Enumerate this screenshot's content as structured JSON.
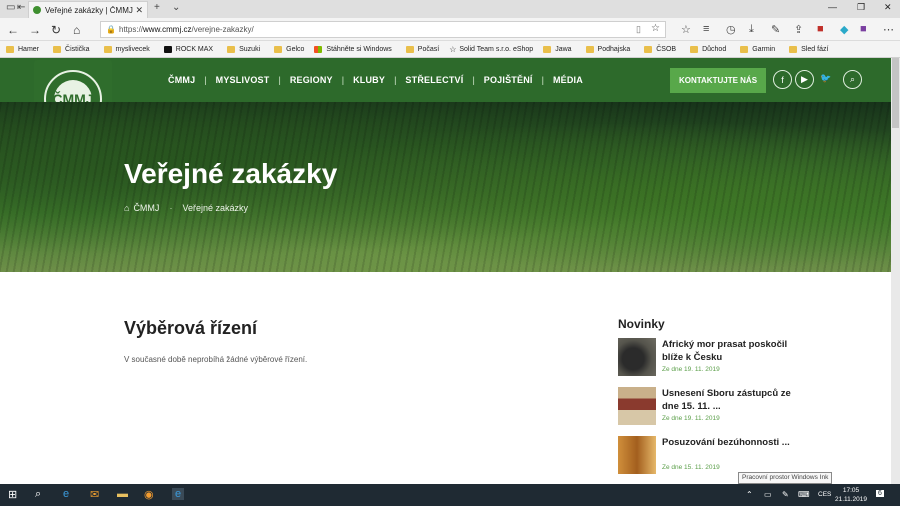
{
  "browser": {
    "tab_title": "Veřejné zakázky | ČMMJ",
    "tab_close": "✕",
    "new_tab": "+",
    "tab_menu": "⌄",
    "url_scheme": "https://",
    "url_host": "www.cmmj.cz",
    "url_path": "/verejne-zakazky/",
    "bookmarks": [
      "Hamer",
      "Čistička",
      "myslivecek",
      "ROCK MAX",
      "Suzuki",
      "Gelco",
      "Stáhněte si Windows",
      "Počasí",
      "Solid Team s.r.o. eShop",
      "Jawa",
      "Podhajska",
      "ČSOB",
      "Důchod",
      "Garmin",
      "Sled fází"
    ]
  },
  "site": {
    "logo_text": "ČMMJ",
    "nav": [
      "ČMMJ",
      "MYSLIVOST",
      "REGIONY",
      "KLUBY",
      "STŘELECTVÍ",
      "POJIŠTĚNÍ",
      "MÉDIA"
    ],
    "contact_button": "KONTAKTUJTE NÁS",
    "hero_title": "Veřejné zakázky",
    "breadcrumb": {
      "home": "ČMMJ",
      "current": "Veřejné zakázky"
    }
  },
  "content": {
    "title": "Výběrová řízení",
    "text": "V současné době neprobíhá žádné výběrové řízení."
  },
  "news": {
    "heading": "Novinky",
    "items": [
      {
        "title": "Africký mor prasat poskočil blíže k Česku",
        "date": "Ze dne 19. 11. 2019"
      },
      {
        "title": "Usnesení Sboru zástupců ze dne 15. 11. ...",
        "date": "Ze dne 19. 11. 2019"
      },
      {
        "title": "Posuzování bezúhonnosti ...",
        "date": "Ze dne 15. 11. 2019"
      }
    ]
  },
  "tooltip": "Pracovní prostor Windows Ink",
  "taskbar": {
    "language": "CES",
    "time": "17:05",
    "date": "21.11.2019",
    "notifications": "6"
  }
}
